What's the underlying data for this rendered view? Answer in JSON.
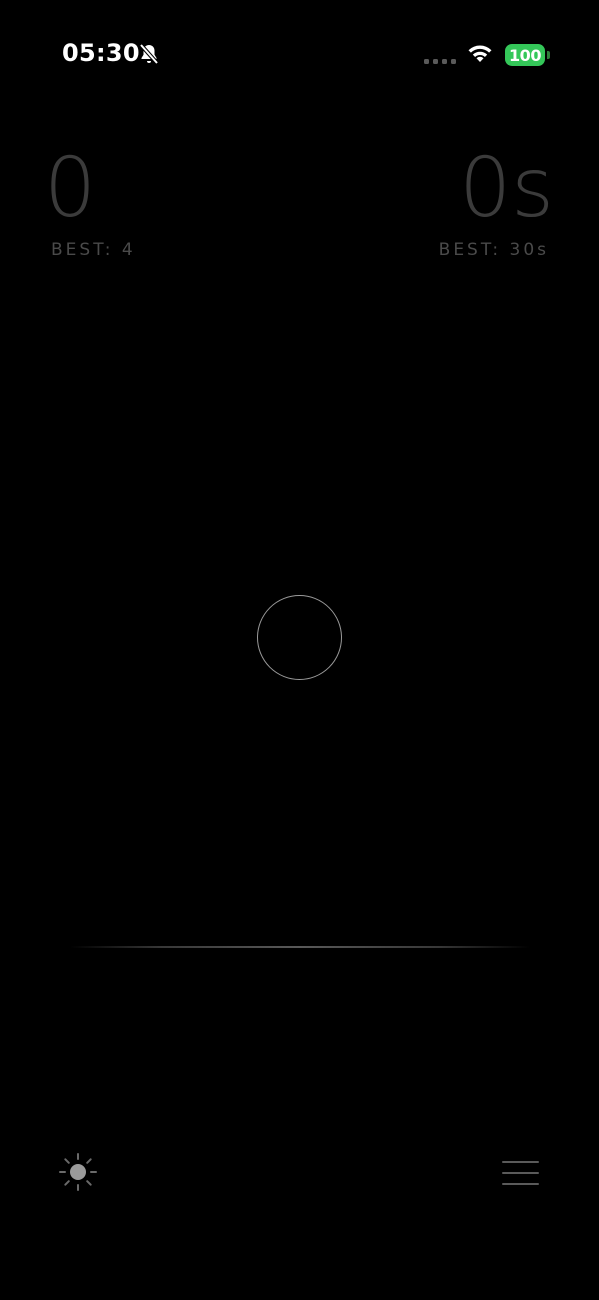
{
  "status_bar": {
    "time": "05:30",
    "battery_level": "100",
    "icons": [
      "bell-slash-icon",
      "signal-icon",
      "wifi-icon",
      "battery-icon"
    ],
    "battery_color": "#34c759"
  },
  "scoreboard": {
    "score_value": "0",
    "score_best": "BEST: 4",
    "time_value": "0s",
    "time_best": "BEST: 30s"
  },
  "controls": {
    "brightness_icon": "sun-icon",
    "menu_icon": "hamburger-menu-icon"
  },
  "theme": {
    "background": "#000000",
    "text_dim": "#3b3b3b",
    "circle_stroke": "#9a9a9a"
  }
}
